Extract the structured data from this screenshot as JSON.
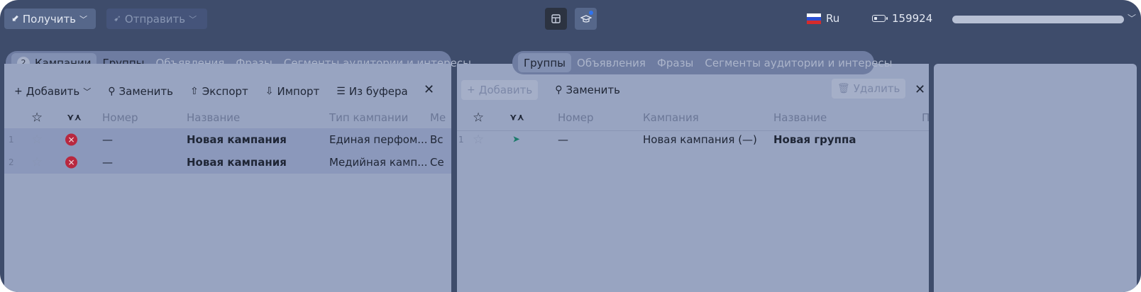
{
  "topbar": {
    "get_label": "Получить",
    "send_label": "Отправить",
    "language": "Ru",
    "units": "159924"
  },
  "colors": {
    "accent": "#2f73f0",
    "error": "#b8283f",
    "flag": [
      "#ffffff",
      "#2c4fd1",
      "#d52b2b"
    ]
  },
  "panel_campaigns": {
    "tabs": [
      {
        "badge": "2",
        "label": "Кампании"
      },
      {
        "label": "Группы"
      },
      {
        "label": "Объявления"
      },
      {
        "label": "Фразы"
      },
      {
        "label": "Сегменты аудитории и интересы"
      }
    ],
    "toolbar": {
      "add": "Добавить",
      "replace": "Заменить",
      "export": "Экспорт",
      "import": "Импорт",
      "from_buffer": "Из буфера"
    },
    "columns": {
      "number": "Номер",
      "name": "Название",
      "type": "Тип кампании",
      "more": "Ме"
    },
    "rows": [
      {
        "idx": "1",
        "number": "—",
        "name": "Новая кампания",
        "type": "Единая перфом...",
        "more": "Вс"
      },
      {
        "idx": "2",
        "number": "—",
        "name": "Новая кампания",
        "type": "Медийная камп...",
        "more": "Се"
      }
    ]
  },
  "panel_groups": {
    "tabs": [
      {
        "label": "Группы"
      },
      {
        "label": "Объявления"
      },
      {
        "label": "Фразы"
      },
      {
        "label": "Сегменты аудитории и интересы"
      }
    ],
    "toolbar": {
      "add": "Добавить",
      "replace": "Заменить",
      "delete": "Удалить"
    },
    "columns": {
      "number": "Номер",
      "campaign": "Кампания",
      "name": "Название",
      "more": "П"
    },
    "rows": [
      {
        "idx": "1",
        "number": "—",
        "campaign": "Новая кампания (—)",
        "name": "Новая группа"
      }
    ]
  }
}
